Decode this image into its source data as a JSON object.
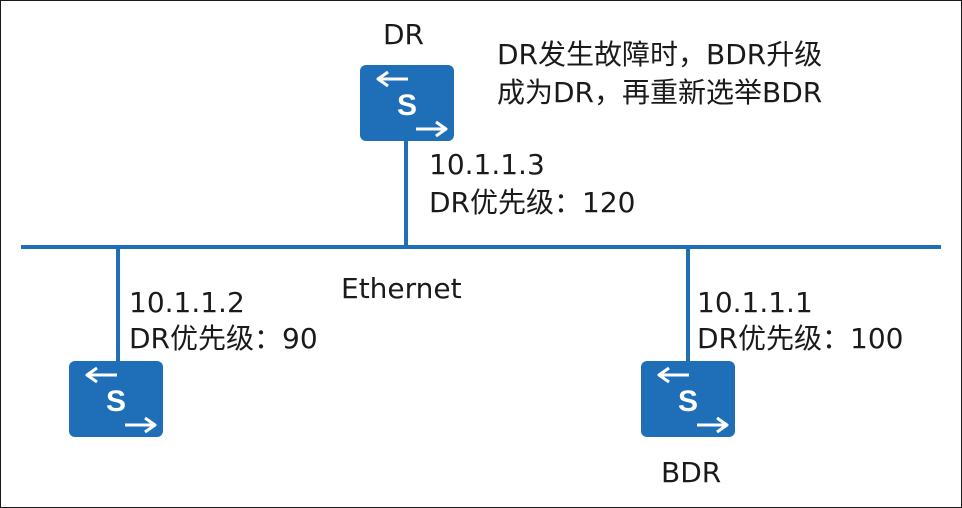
{
  "colors": {
    "line": "#1f6fb8",
    "device_fill": "#1f6fb8",
    "device_glyph": "#ffffff",
    "text": "#1a1a1a"
  },
  "network": {
    "label": "Ethernet"
  },
  "note": {
    "line1": "DR发生故障时，BDR升级",
    "line2": "成为DR，再重新选举BDR"
  },
  "routers": [
    {
      "role": "DR",
      "ip": "10.1.1.3",
      "priority": "DR优先级：120",
      "icon": "switch-icon"
    },
    {
      "role": "",
      "ip": "10.1.1.2",
      "priority": "DR优先级：90",
      "icon": "switch-icon"
    },
    {
      "role": "BDR",
      "ip": "10.1.1.1",
      "priority": "DR优先级：100",
      "icon": "switch-icon"
    }
  ]
}
